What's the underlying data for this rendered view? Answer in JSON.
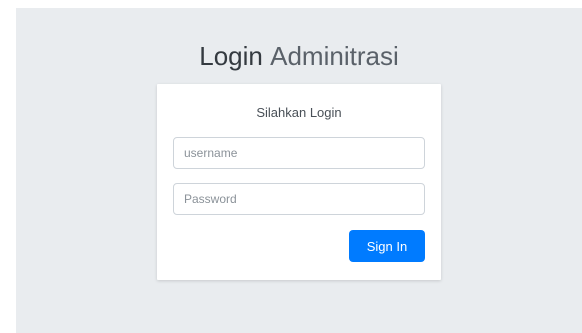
{
  "header": {
    "title_bold": "Login",
    "title_light": "Adminitrasi"
  },
  "card": {
    "message": "Silahkan Login",
    "username": {
      "placeholder": "username",
      "value": ""
    },
    "password": {
      "placeholder": "Password",
      "value": ""
    },
    "submit_label": "Sign In"
  },
  "colors": {
    "background": "#e9ecef",
    "card": "#ffffff",
    "primary": "#007bff"
  }
}
